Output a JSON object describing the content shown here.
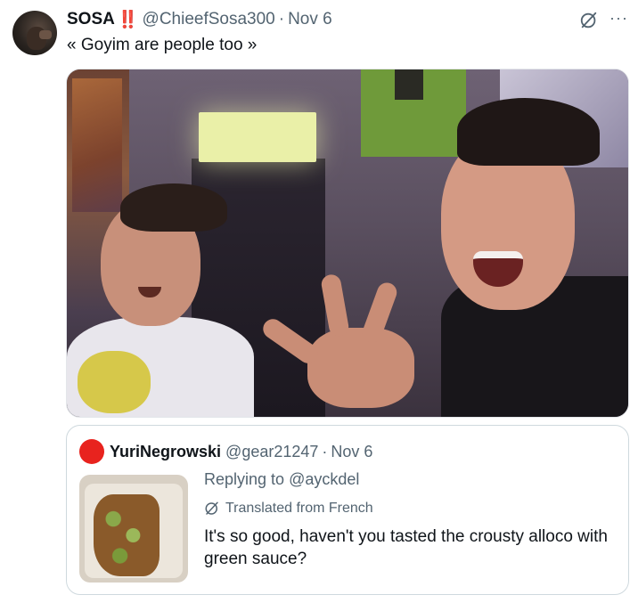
{
  "tweet": {
    "author": {
      "display_name": "SOSA",
      "badge": "‼️",
      "handle": "@ChieefSosa300",
      "separator": "·",
      "date": "Nov 6"
    },
    "text": "« Goyim are people too »",
    "icons": [
      "grok-icon",
      "more-icon"
    ]
  },
  "quoted_tweet": {
    "author": {
      "display_name": "YuriNegrowski",
      "handle": "@gear21247",
      "separator": "·",
      "date": "Nov 6"
    },
    "replying_to_prefix": "Replying to",
    "replying_to_mention": "@ayckdel",
    "translated_label": "Translated from French",
    "text": "It's so good, haven't you tasted the crousty alloco with green sauce?"
  },
  "colors": {
    "text_primary": "#0f1419",
    "text_secondary": "#536471",
    "badge": "#e0245e",
    "quote_avatar": "#e8231e",
    "border": "#cfd9de"
  }
}
